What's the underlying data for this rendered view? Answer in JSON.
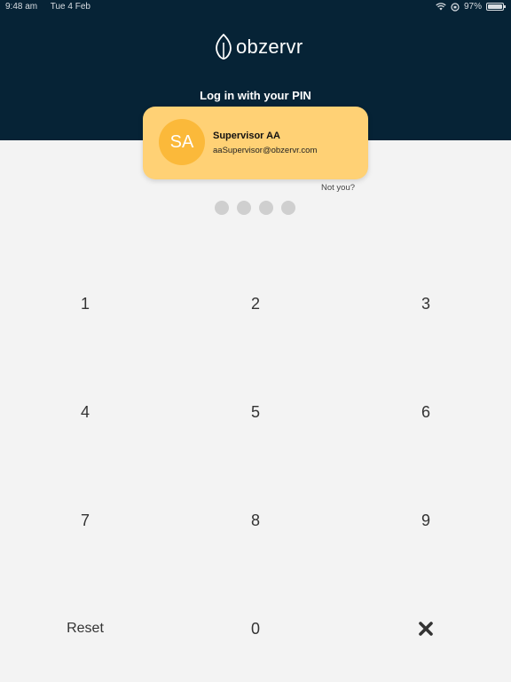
{
  "status_bar": {
    "time": "9:48 am",
    "date": "Tue 4 Feb",
    "battery": "97%",
    "battery_level": 0.97
  },
  "brand": {
    "name": "obzervr"
  },
  "login": {
    "title": "Log in with your PIN"
  },
  "user": {
    "initials": "SA",
    "name": "Supervisor AA",
    "email": "aaSupervisor@obzervr.com",
    "not_you": "Not you?"
  },
  "pin": {
    "length": 4,
    "entered": 0
  },
  "keypad": {
    "k1": "1",
    "k2": "2",
    "k3": "3",
    "k4": "4",
    "k5": "5",
    "k6": "6",
    "k7": "7",
    "k8": "8",
    "k9": "9",
    "reset": "Reset",
    "k0": "0",
    "delete_icon": "close-icon"
  },
  "colors": {
    "header": "#062336",
    "card": "#ffd175",
    "avatar": "#fbb93a",
    "background": "#f3f3f3"
  }
}
